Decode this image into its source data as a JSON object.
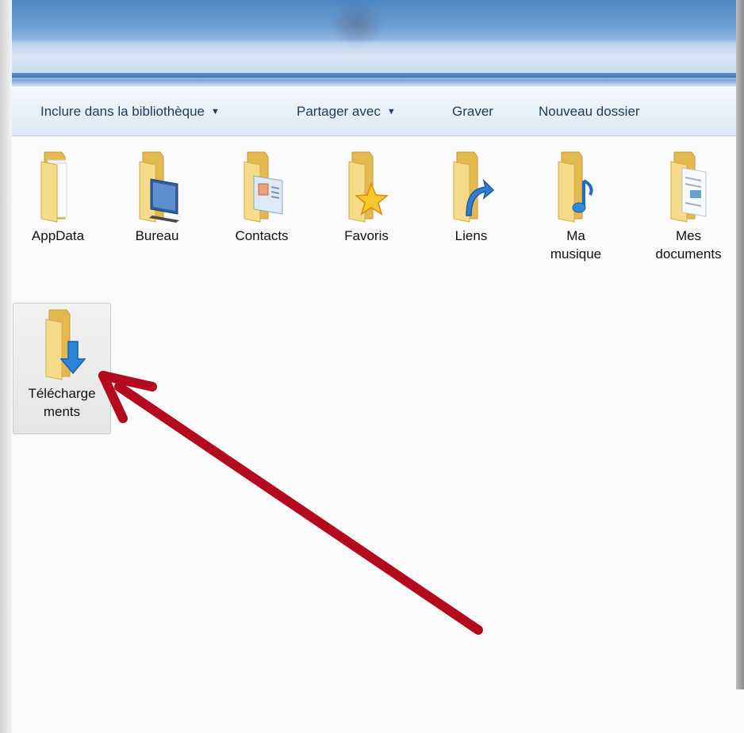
{
  "toolbar": {
    "include_label": "Inclure dans la bibliothèque",
    "share_label": "Partager avec",
    "burn_label": "Graver",
    "new_folder_label": "Nouveau dossier",
    "dropdown_arrow": "▼"
  },
  "folders": [
    {
      "label": "AppData",
      "icon": "folder-plain-icon"
    },
    {
      "label": "Bureau",
      "icon": "folder-desktop-icon"
    },
    {
      "label": "Contacts",
      "icon": "folder-contacts-icon"
    },
    {
      "label": "Favoris",
      "icon": "folder-favorites-icon"
    },
    {
      "label": "Liens",
      "icon": "folder-links-icon"
    },
    {
      "label": "Ma musique",
      "label_line1": "Ma",
      "label_line2": "musique",
      "icon": "folder-music-icon"
    },
    {
      "label": "Mes documents",
      "label_line1": "Mes",
      "label_line2": "documents",
      "icon": "folder-documents-icon"
    },
    {
      "label": "Téléchargements",
      "label_line1": "Télécharge",
      "label_line2": "ments",
      "icon": "folder-downloads-icon",
      "selected": true
    }
  ],
  "colors": {
    "folder_body": "#f4d77e",
    "folder_back": "#e9c25f",
    "selection_bg": "#e8e8e8",
    "annotation_arrow": "#b00a1f",
    "download_arrow": "#2a7fd4"
  }
}
